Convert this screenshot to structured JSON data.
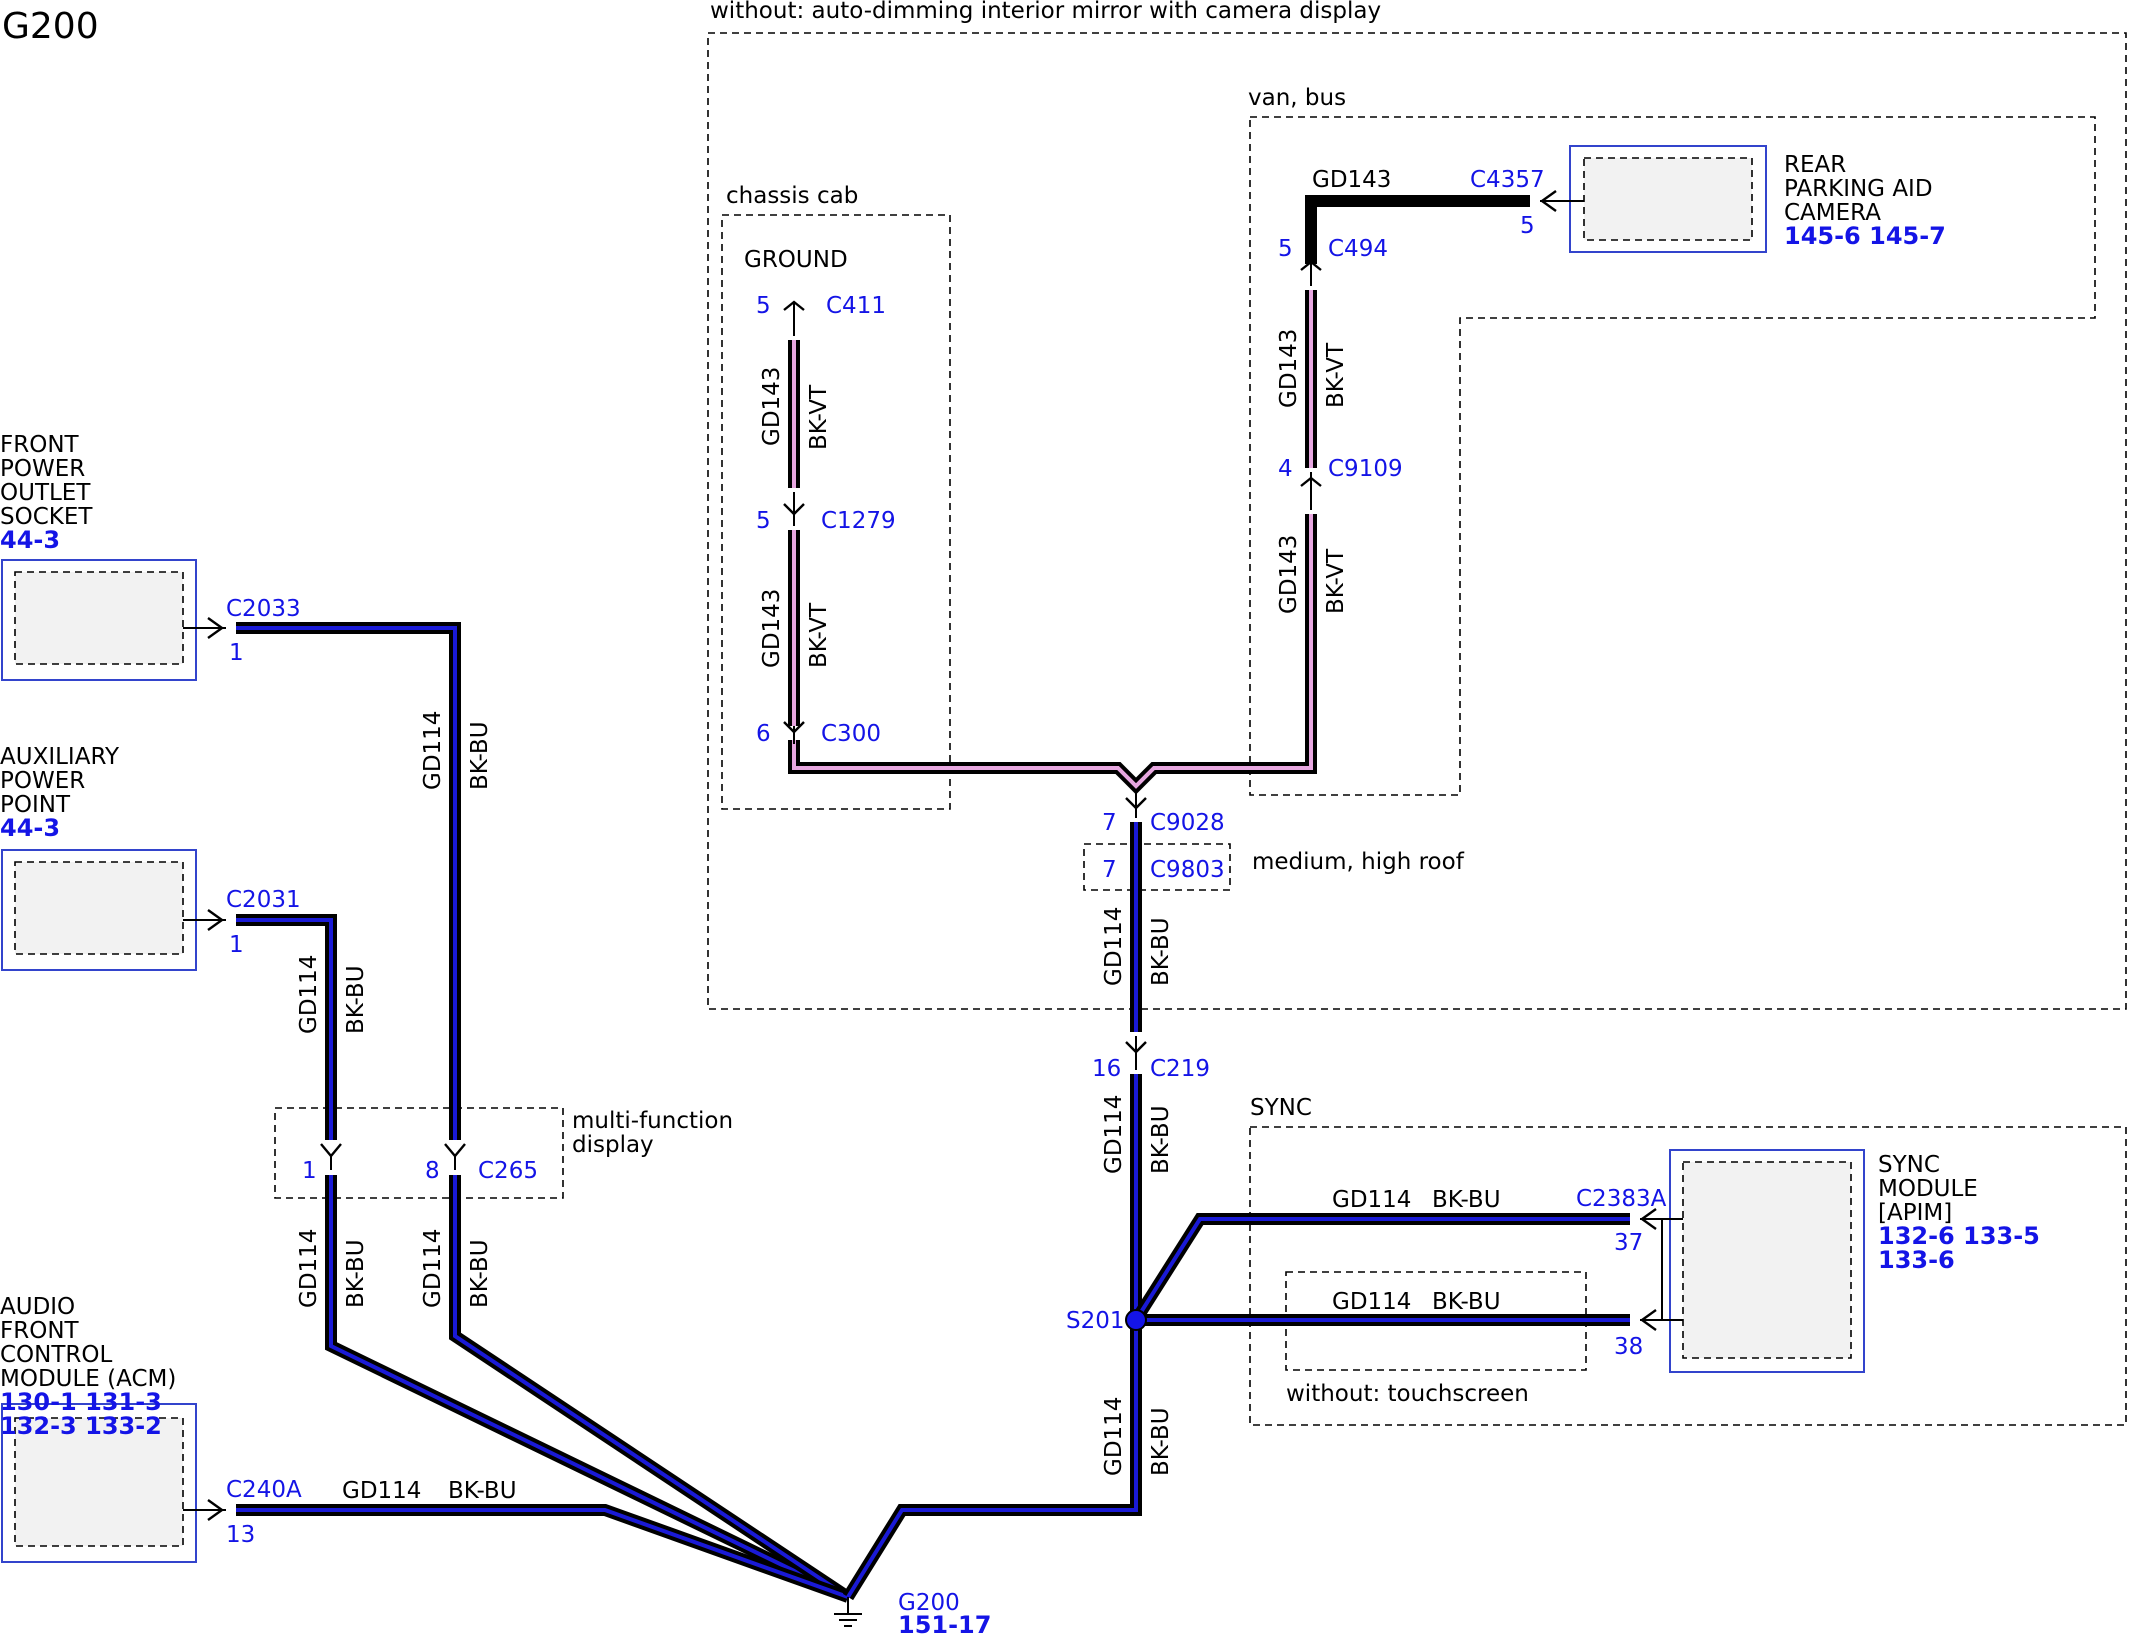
{
  "page_title": "G200",
  "regions": {
    "without_mirror": "without: auto-dimming interior mirror with camera display",
    "chassis_cab": "chassis cab",
    "van_bus": "van, bus",
    "medium_high_roof": "medium, high roof",
    "multi_function_display": [
      "multi-function",
      "display"
    ],
    "sync": "SYNC",
    "without_touchscreen": "without: touchscreen"
  },
  "components": {
    "front_power_outlet": {
      "name": [
        "FRONT",
        "POWER",
        "OUTLET",
        "SOCKET"
      ],
      "refs": [
        "44-3"
      ]
    },
    "auxiliary_power_point": {
      "name": [
        "AUXILIARY",
        "POWER",
        "POINT"
      ],
      "refs": [
        "44-3"
      ]
    },
    "audio_front_control_module": {
      "name": [
        "AUDIO",
        "FRONT",
        "CONTROL",
        "MODULE (ACM)"
      ],
      "refs": [
        "130-1 131-3",
        "132-3 133-2"
      ]
    },
    "rear_parking_aid_camera": {
      "name": [
        "REAR",
        "PARKING AID",
        "CAMERA"
      ],
      "refs": [
        "145-6 145-7"
      ]
    },
    "sync_module": {
      "name": [
        "SYNC",
        "MODULE",
        "[APIM]"
      ],
      "refs": [
        "132-6 133-5",
        "133-6"
      ]
    },
    "ground": {
      "name": "GROUND"
    }
  },
  "connectors": {
    "c2033": {
      "id": "C2033",
      "pin": "1"
    },
    "c2031": {
      "id": "C2031",
      "pin": "1"
    },
    "c240a": {
      "id": "C240A",
      "pin": "13"
    },
    "c265": {
      "id": "C265",
      "pins": [
        "1",
        "8"
      ]
    },
    "c411": {
      "id": "C411",
      "pin": "5"
    },
    "c1279": {
      "id": "C1279",
      "pin": "5"
    },
    "c300": {
      "id": "C300",
      "pin": "6"
    },
    "c4357": {
      "id": "C4357",
      "pin": "5"
    },
    "c494": {
      "id": "C494",
      "pin": "5"
    },
    "c9109": {
      "id": "C9109",
      "pin": "4"
    },
    "c9028": {
      "id": "C9028",
      "pin": "7"
    },
    "c9803": {
      "id": "C9803",
      "pin": "7"
    },
    "c219": {
      "id": "C219",
      "pin": "16"
    },
    "c2383a": {
      "id": "C2383A",
      "pins": [
        "37",
        "38"
      ]
    }
  },
  "splice": {
    "id": "S201"
  },
  "ground_point": {
    "id": "G200",
    "ref": "151-17"
  },
  "wires": {
    "gd114": {
      "circuit": "GD114",
      "color": "BK-BU"
    },
    "gd143": {
      "circuit": "GD143",
      "color": "BK-VT"
    }
  },
  "colors": {
    "wire_outline": "#000000",
    "bk_bu_stripe": "#1a1ad6",
    "bk_vt_stripe": "#e7a7e0",
    "label_blue": "#1414e6",
    "component_border": "#3344cc"
  }
}
